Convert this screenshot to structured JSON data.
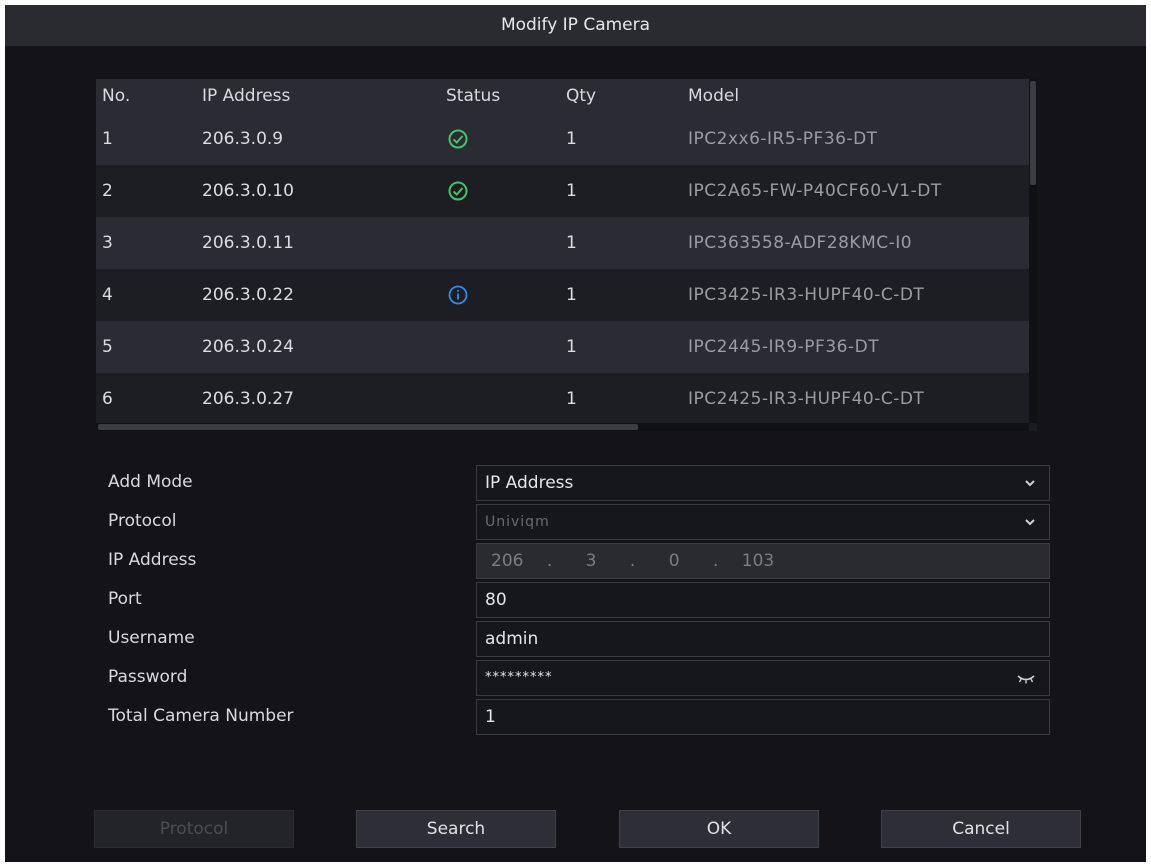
{
  "dialog": {
    "title": "Modify IP Camera"
  },
  "table": {
    "headers": {
      "no": "No.",
      "ip": "IP Address",
      "status": "Status",
      "qty": "Qty",
      "model": "Model"
    },
    "rows": [
      {
        "no": "1",
        "ip": "206.3.0.9",
        "status": "ok",
        "qty": "1",
        "model": "IPC2xx6-IR5-PF36-DT"
      },
      {
        "no": "2",
        "ip": "206.3.0.10",
        "status": "ok",
        "qty": "1",
        "model": "IPC2A65-FW-P40CF60-V1-DT"
      },
      {
        "no": "3",
        "ip": "206.3.0.11",
        "status": "",
        "qty": "1",
        "model": "IPC363558-ADF28KMC-I0"
      },
      {
        "no": "4",
        "ip": "206.3.0.22",
        "status": "info",
        "qty": "1",
        "model": "IPC3425-IR3-HUPF40-C-DT"
      },
      {
        "no": "5",
        "ip": "206.3.0.24",
        "status": "",
        "qty": "1",
        "model": "IPC2445-IR9-PF36-DT"
      },
      {
        "no": "6",
        "ip": "206.3.0.27",
        "status": "",
        "qty": "1",
        "model": "IPC2425-IR3-HUPF40-C-DT"
      }
    ]
  },
  "form": {
    "add_mode": {
      "label": "Add Mode",
      "value": "IP Address"
    },
    "protocol": {
      "label": "Protocol",
      "value": "Univiqm"
    },
    "ip_address": {
      "label": "IP Address",
      "parts": [
        "206",
        ".",
        "3",
        ".",
        "0",
        ".",
        "103"
      ]
    },
    "port": {
      "label": "Port",
      "value": "80"
    },
    "username": {
      "label": "Username",
      "value": "admin"
    },
    "password": {
      "label": "Password",
      "value": "*********"
    },
    "total_camera_number": {
      "label": "Total Camera Number",
      "value": "1"
    }
  },
  "buttons": {
    "protocol": "Protocol",
    "search": "Search",
    "ok": "OK",
    "cancel": "Cancel"
  },
  "colors": {
    "ok_status": "#43c36a",
    "info_status": "#2d8cf0"
  }
}
